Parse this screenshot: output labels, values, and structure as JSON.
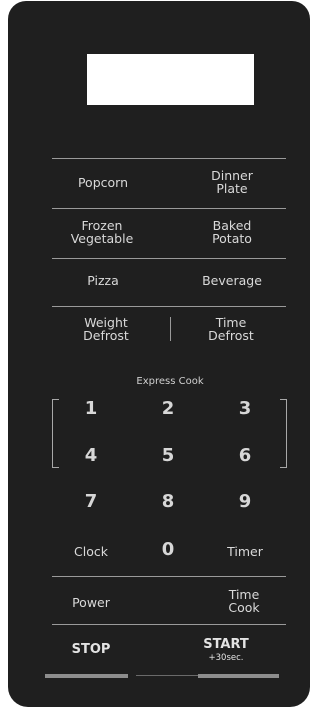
{
  "display": {
    "value": ""
  },
  "buttons": {
    "popcorn": "Popcorn",
    "dinner_plate": "Dinner\nPlate",
    "frozen_vegetable": "Frozen\nVegetable",
    "baked_potato": "Baked\nPotato",
    "pizza": "Pizza",
    "beverage": "Beverage",
    "weight_defrost": "Weight\nDefrost",
    "time_defrost": "Time\nDefrost",
    "express_cook_label": "Express Cook",
    "clock": "Clock",
    "timer": "Timer",
    "power": "Power",
    "time_cook": "Time\nCook",
    "stop": "STOP",
    "start": "START",
    "start_sub": "+30sec."
  },
  "digits": [
    "1",
    "2",
    "3",
    "4",
    "5",
    "6",
    "7",
    "8",
    "9",
    "0"
  ],
  "colors": {
    "panel": "#1f1f1f",
    "display": "#ffffff",
    "text": "#d9d9d9",
    "divider": "#9a9a9a",
    "bar": "#8d8d8d"
  }
}
